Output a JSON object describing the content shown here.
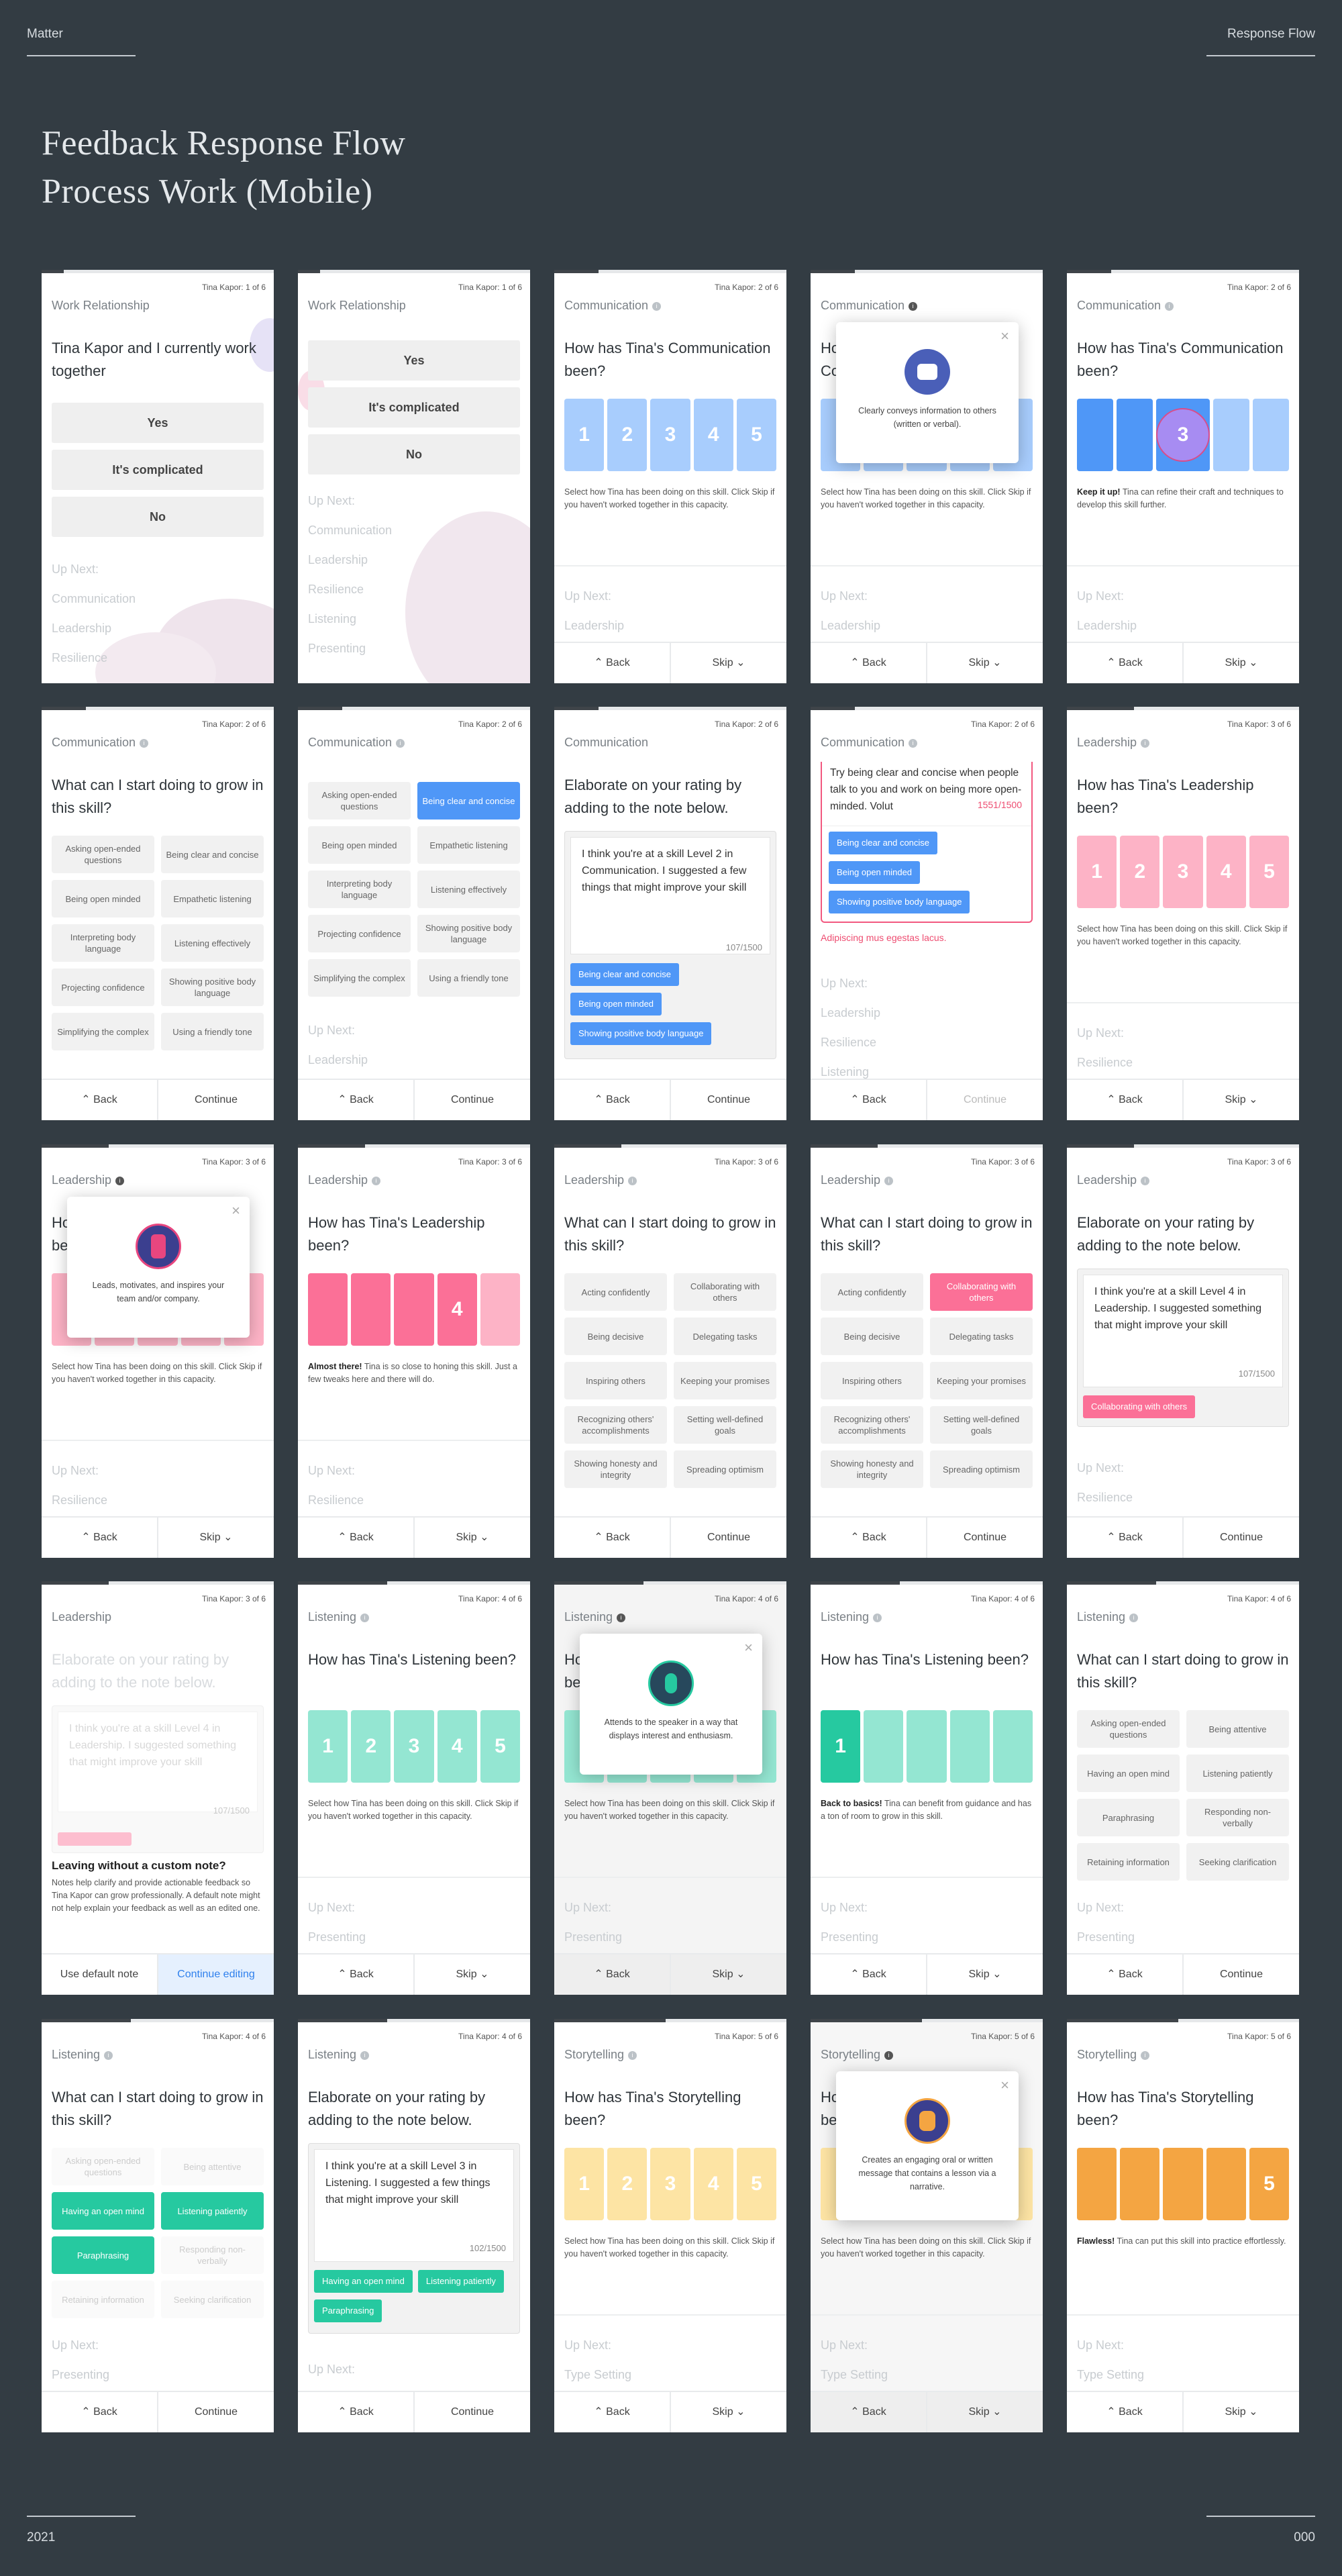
{
  "header": {
    "left": "Matter",
    "right": "Response Flow"
  },
  "footer": {
    "left": "2021",
    "right": "000"
  },
  "title_lines": [
    "Feedback Response Flow",
    "Process Work (Mobile)"
  ],
  "colors": {
    "blue": "#4f97f7",
    "blue_light": "#a8cdfd",
    "pink": "#fb7097",
    "pink_light": "#fdb3c6",
    "teal": "#26c9a0",
    "teal_light": "#94e6d2",
    "yellow_light": "#fde4a4",
    "orange": "#f4a542",
    "purple": "#a78cf2"
  },
  "nav": {
    "back": "⌃ Back",
    "skip": "Skip ⌄",
    "continue": "Continue"
  },
  "skip_desc": "Select how Tina has been doing on this skill. Click Skip if you haven't worked together in this capacity.",
  "up_next": "Up Next:",
  "q_start": "What can I start doing to grow in this skill?",
  "q_elaborate": "Elaborate on your rating by adding to the note below.",
  "screens": [
    {
      "counter": "Tina Kapor: 1 of 6",
      "section": "Work Relationship",
      "question": "Tina Kapor and I currently work together",
      "options": [
        "Yes",
        "It's complicated",
        "No"
      ],
      "up_next": [
        "Communication",
        "Leadership",
        "Resilience"
      ]
    },
    {
      "counter": "Tina Kapor: 1 of 6",
      "section": "Work Relationship",
      "options": [
        "Yes",
        "It's complicated",
        "No"
      ],
      "up_next": [
        "Communication",
        "Leadership",
        "Resilience",
        "Listening",
        "Presenting"
      ]
    },
    {
      "counter": "Tina Kapor: 2 of 6",
      "section": "Communication",
      "question": "How has Tina's Communication been?",
      "ratings": [
        "1",
        "2",
        "3",
        "4",
        "5"
      ],
      "up_next": [
        "Leadership"
      ]
    },
    {
      "counter": "",
      "section": "Communication",
      "question": "How has Tina's Communication been?",
      "popup": "Clearly conveys information to others (written or verbal).",
      "up_next": [
        "Leadership"
      ]
    },
    {
      "counter": "Tina Kapor: 2 of 6",
      "section": "Communication",
      "question": "How has Tina's Communication been?",
      "selected": "3",
      "feedback_bold": "Keep it up!",
      "feedback": "Tina can refine their craft and techniques to develop this skill further.",
      "up_next": [
        "Leadership"
      ]
    },
    {
      "counter": "Tina Kapor: 2 of 6",
      "section": "Communication",
      "chips": [
        "Asking open-ended questions",
        "Being clear and concise",
        "Being open minded",
        "Empathetic listening",
        "Interpreting body language",
        "Listening effectively",
        "Projecting confidence",
        "Showing positive body language",
        "Simplifying the complex",
        "Using a friendly tone"
      ]
    },
    {
      "counter": "Tina Kapor: 2 of 6",
      "section": "Communication",
      "chips": [
        "Asking open-ended questions",
        "Being clear and concise",
        "Being open minded",
        "Empathetic listening",
        "Interpreting body language",
        "Listening effectively",
        "Projecting confidence",
        "Showing positive body language",
        "Simplifying the complex",
        "Using a friendly tone"
      ],
      "up_next": [
        "Leadership"
      ]
    },
    {
      "counter": "Tina Kapor: 2 of 6",
      "section": "Communication",
      "note": "I think you're at a skill Level 2 in Communication. I suggested a few things that might improve your skill",
      "count": "107/1500",
      "tags": [
        "Being clear and concise",
        "Being open minded",
        "Showing positive body language"
      ]
    },
    {
      "counter": "Tina Kapor: 2 of 6",
      "section": "Communication",
      "note": "Try being clear and concise when people talk to you and work on being more open-minded. Volut",
      "count": "1551/1500",
      "tags": [
        "Being clear and concise",
        "Being open minded",
        "Showing positive body language"
      ],
      "error": "Adipiscing mus egestas lacus.",
      "up_next": [
        "Leadership",
        "Resilience",
        "Listening"
      ]
    },
    {
      "counter": "Tina Kapor: 3 of 6",
      "section": "Leadership",
      "question": "How has Tina's Leadership been?",
      "ratings": [
        "1",
        "2",
        "3",
        "4",
        "5"
      ],
      "up_next": [
        "Resilience"
      ]
    },
    {
      "counter": "Tina Kapor: 3 of 6",
      "section": "Leadership",
      "question": "How has Tina's Leadership been?",
      "popup": "Leads, motivates, and inspires your team and/or company.",
      "up_next": [
        "Resilience"
      ]
    },
    {
      "counter": "Tina Kapor: 3 of 6",
      "section": "Leadership",
      "question": "How has Tina's Leadership been?",
      "selected": "4",
      "feedback_bold": "Almost there!",
      "feedback": "Tina is so close to honing this skill. Just a few tweaks here and there will do.",
      "up_next": [
        "Resilience"
      ]
    },
    {
      "counter": "Tina Kapor: 3 of 6",
      "section": "Leadership",
      "chips": [
        "Acting confidently",
        "Collaborating with others",
        "Being decisive",
        "Delegating tasks",
        "Inspiring others",
        "Keeping your promises",
        "Recognizing others' accomplishments",
        "Setting well-defined goals",
        "Showing honesty and integrity",
        "Spreading optimism"
      ]
    },
    {
      "counter": "Tina Kapor: 3 of 6",
      "section": "Leadership",
      "chips": [
        "Acting confidently",
        "Collaborating with others",
        "Being decisive",
        "Delegating tasks",
        "Inspiring others",
        "Keeping your promises",
        "Recognizing others' accomplishments",
        "Setting well-defined goals",
        "Showing honesty and integrity",
        "Spreading optimism"
      ]
    },
    {
      "counter": "Tina Kapor: 3 of 6",
      "section": "Leadership",
      "note": "I think you're at a skill Level 4 in Leadership. I suggested something that might improve your skill",
      "count": "107/1500",
      "tags": [
        "Collaborating with others"
      ],
      "up_next": [
        "Resilience"
      ]
    },
    {
      "counter": "Tina Kapor: 3 of 6",
      "section": "Leadership",
      "note": "I think you're at a skill Level 4 in Leadership. I suggested something that might improve your skill",
      "count": "107/1500",
      "leave_title": "Leaving without a custom note?",
      "leave_text": "Notes help clarify and provide actionable feedback so Tina Kapor can grow professionally. A default note might not help explain your feedback as well as an edited one.",
      "btn_default": "Use default note",
      "btn_edit": "Continue editing"
    },
    {
      "counter": "Tina Kapor: 4 of 6",
      "section": "Listening",
      "question": "How has Tina's Listening been?",
      "ratings": [
        "1",
        "2",
        "3",
        "4",
        "5"
      ],
      "up_next": [
        "Presenting"
      ]
    },
    {
      "counter": "Tina Kapor: 4 of 6",
      "section": "Listening",
      "question": "How has Tina's Listening been?",
      "popup": "Attends to the speaker in a way that displays interest and enthusiasm.",
      "up_next": [
        "Presenting"
      ]
    },
    {
      "counter": "Tina Kapor: 4 of 6",
      "section": "Listening",
      "question": "How has Tina's Listening been?",
      "selected": "1",
      "feedback_bold": "Back to basics!",
      "feedback": "Tina can benefit from guidance and has a ton of room to grow in this skill.",
      "up_next": [
        "Presenting"
      ]
    },
    {
      "counter": "Tina Kapor: 4 of 6",
      "section": "Listening",
      "chips": [
        "Asking open-ended questions",
        "Being attentive",
        "Having an open mind",
        "Listening patiently",
        "Paraphrasing",
        "Responding non-verbally",
        "Retaining information",
        "Seeking clarification"
      ],
      "up_next": [
        "Presenting"
      ]
    },
    {
      "counter": "Tina Kapor: 4 of 6",
      "section": "Listening",
      "chips": [
        "Asking open-ended questions",
        "Being attentive",
        "Having an open mind",
        "Listening patiently",
        "Paraphrasing",
        "Responding non-verbally",
        "Retaining information",
        "Seeking clarification"
      ],
      "up_next": [
        "Presenting"
      ]
    },
    {
      "counter": "Tina Kapor: 4 of 6",
      "section": "Listening",
      "note": "I think you're at a skill Level 3 in Listening. I suggested a few things that might improve your skill",
      "count": "102/1500",
      "tags": [
        "Having an open mind",
        "Listening patiently",
        "Paraphrasing"
      ],
      "up_next": []
    },
    {
      "counter": "Tina Kapor: 5 of 6",
      "section": "Storytelling",
      "question": "How has Tina's Storytelling been?",
      "ratings": [
        "1",
        "2",
        "3",
        "4",
        "5"
      ],
      "up_next": [
        "Type Setting"
      ]
    },
    {
      "counter": "Tina Kapor: 5 of 6",
      "section": "Storytelling",
      "question": "How has Tina's Storytelling been?",
      "popup": "Creates an engaging oral or written message that contains a lesson via a narrative.",
      "up_next": [
        "Type Setting"
      ]
    },
    {
      "counter": "Tina Kapor: 5 of 6",
      "section": "Storytelling",
      "question": "How has Tina's Storytelling been?",
      "selected": "5",
      "feedback_bold": "Flawless!",
      "feedback": "Tina can put this skill into practice effortlessly.",
      "up_next": [
        "Type Setting"
      ]
    }
  ]
}
